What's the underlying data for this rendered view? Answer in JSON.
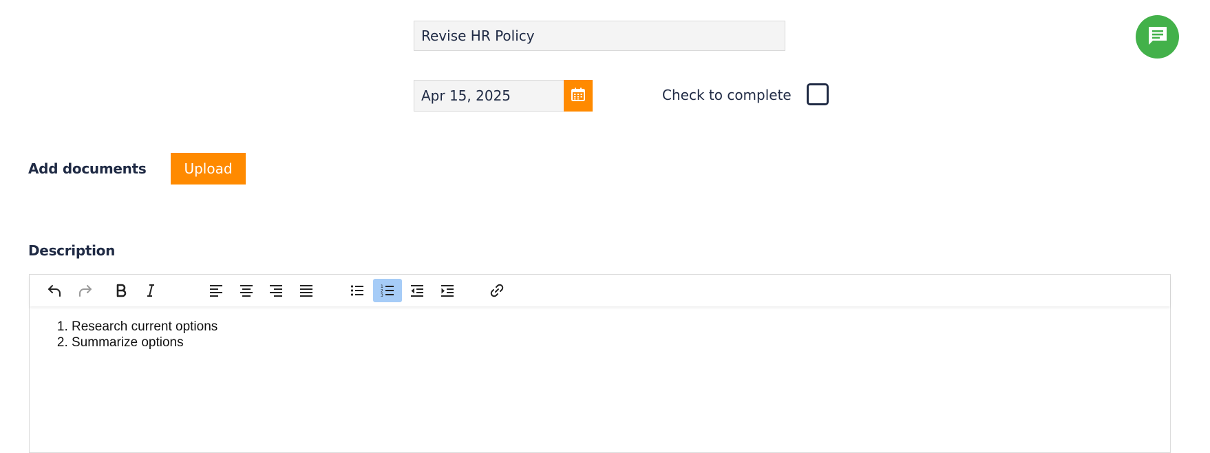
{
  "task": {
    "title_value": "Revise HR Policy",
    "date_value": "Apr 15, 2025",
    "complete_label": "Check to complete"
  },
  "documents": {
    "label": "Add documents",
    "upload_label": "Upload"
  },
  "description": {
    "label": "Description",
    "items": [
      "Research current options",
      "Summarize options"
    ]
  },
  "toolbar": {
    "buttons": [
      "undo",
      "redo",
      "bold",
      "italic",
      "align-left",
      "align-center",
      "align-right",
      "align-justify",
      "bullet-list",
      "numbered-list",
      "outdent",
      "indent",
      "link"
    ],
    "active": "numbered-list"
  },
  "colors": {
    "accent": "#ff8a00",
    "chat": "#43b14a",
    "text": "#1f2a44",
    "active_tool": "#a6ccf7"
  },
  "icons": {
    "calendar": "calendar-icon",
    "chat": "chat-icon"
  }
}
